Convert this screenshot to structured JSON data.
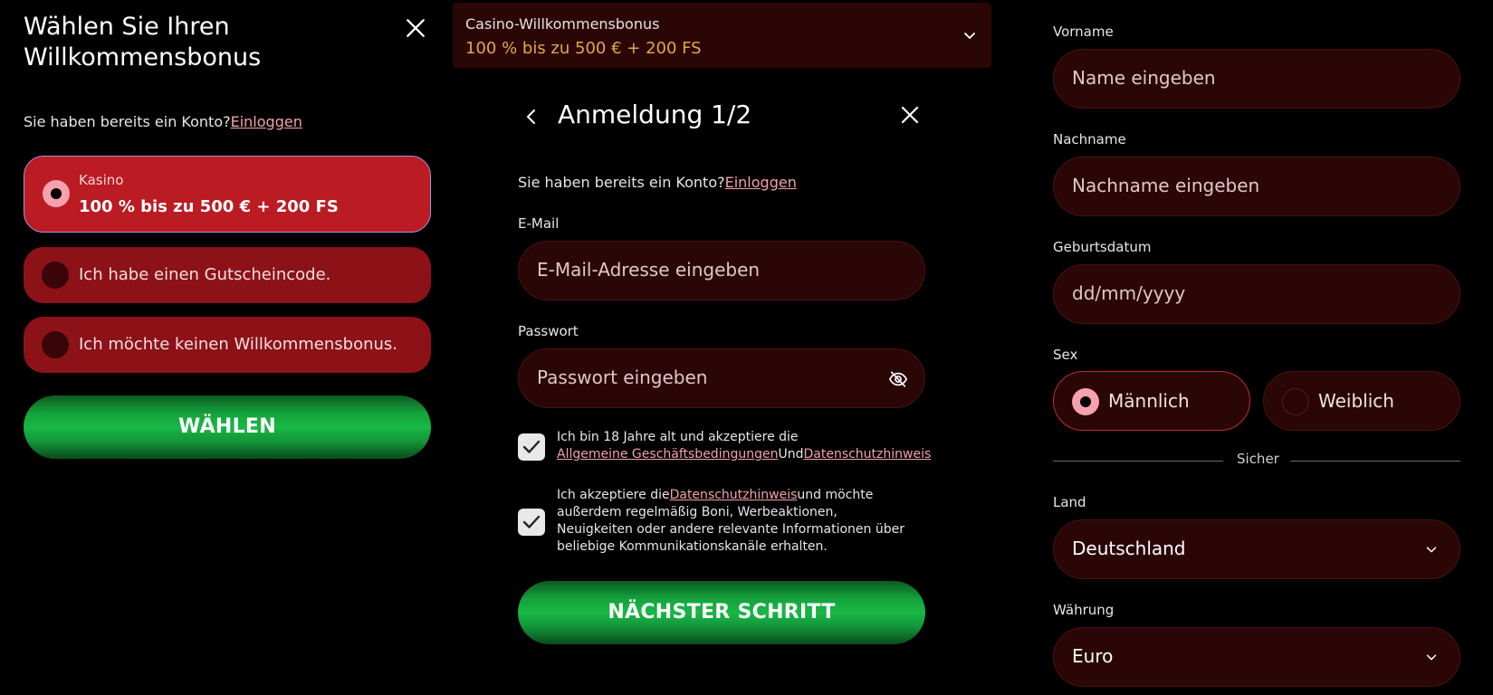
{
  "bonus_select": {
    "title": "Wählen Sie Ihren Willkommensbonus",
    "account_prompt": "Sie haben bereits ein Konto?",
    "login_link": "Einloggen",
    "options": [
      {
        "label": "Kasino",
        "value": "100 % bis zu 500 € + 200 FS",
        "selected": true
      },
      {
        "label": "Ich habe einen Gutscheincode.",
        "selected": false
      },
      {
        "label": "Ich möchte keinen Willkommensbonus.",
        "selected": false
      }
    ],
    "choose_button": "WÄHLEN"
  },
  "registration": {
    "bonus_dropdown": {
      "label": "Casino-Willkommensbonus",
      "value": "100 % bis zu 500 € + 200 FS"
    },
    "title": "Anmeldung 1/2",
    "account_prompt": "Sie haben bereits ein Konto?",
    "login_link": "Einloggen",
    "email": {
      "label": "E-Mail",
      "placeholder": "E-Mail-Adresse eingeben"
    },
    "password": {
      "label": "Passwort",
      "placeholder": "Passwort eingeben"
    },
    "consent_terms": {
      "checked": true,
      "text": "Ich bin 18 Jahre alt und akzeptiere die",
      "link1": "Allgemeine Geschäftsbedingungen",
      "and": "Und",
      "link2": "Datenschutzhinweis"
    },
    "consent_marketing": {
      "checked": true,
      "text_before": "Ich akzeptiere die",
      "link": "Datenschutzhinweis",
      "text_after": "und möchte außerdem regelmäßig Boni, Werbeaktionen, Neuigkeiten oder andere relevante Informationen über beliebige Kommunikationskanäle erhalten."
    },
    "next_button": "NÄCHSTER SCHRITT"
  },
  "personal": {
    "first_name": {
      "label": "Vorname",
      "placeholder": "Name eingeben"
    },
    "last_name": {
      "label": "Nachname",
      "placeholder": "Nachname eingeben"
    },
    "birthdate": {
      "label": "Geburtsdatum",
      "placeholder": "dd/mm/yyyy"
    },
    "sex": {
      "label": "Sex",
      "options": [
        {
          "label": "Männlich",
          "selected": true
        },
        {
          "label": "Weiblich",
          "selected": false
        }
      ]
    },
    "divider_text": "Sicher",
    "country": {
      "label": "Land",
      "value": "Deutschland"
    },
    "currency": {
      "label": "Währung",
      "value": "Euro"
    }
  },
  "colors": {
    "background": "#000000",
    "selected_option": "#bb1b22",
    "option": "#8c1217",
    "input_bg": "#2a0607",
    "link": "#f2a0ae",
    "bonus_highlight": "#e5a64a",
    "button_green": "#18b845"
  },
  "icons": [
    "close-icon",
    "chevron-down-icon",
    "chevron-left-icon",
    "eye-off-icon",
    "checkmark-icon",
    "radio-selected-icon"
  ]
}
